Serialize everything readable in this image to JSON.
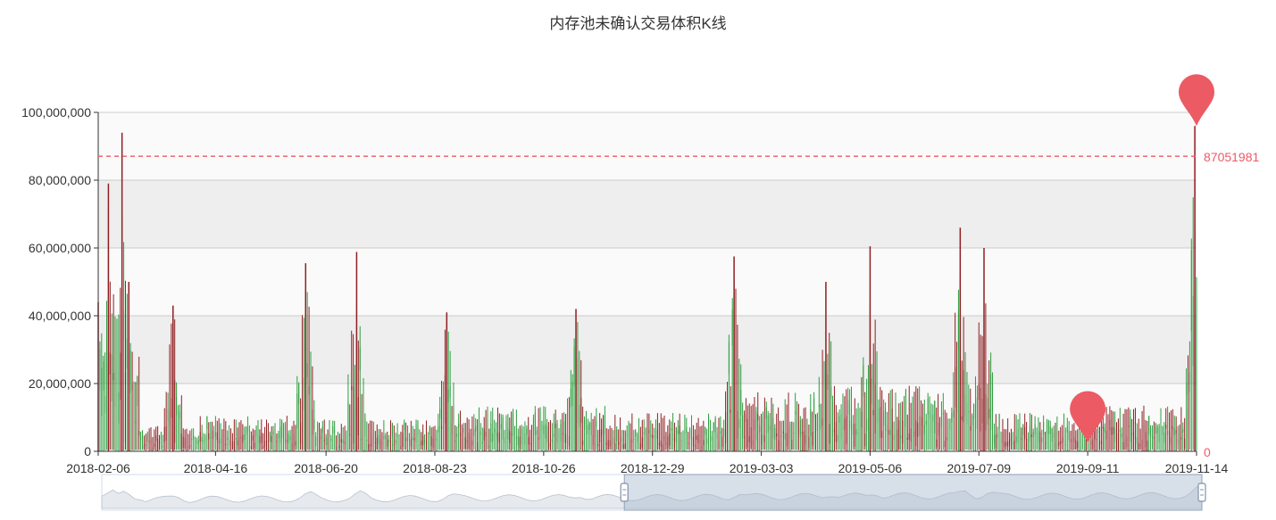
{
  "chart_data": {
    "type": "candlestick",
    "title": "内存池未确认交易体积K线",
    "xlabel": "",
    "ylabel": "",
    "ylim": [
      0,
      100000000
    ],
    "y_ticks": [
      "0",
      "20,000,000",
      "40,000,000",
      "60,000,000",
      "80,000,000",
      "100,000,000"
    ],
    "y_tick_values": [
      0,
      20000000,
      40000000,
      60000000,
      80000000,
      100000000
    ],
    "x_start": "2018-02-06",
    "x_end": "2019-11-14",
    "x_ticks": [
      "2018-02-06",
      "2018-04-16",
      "2018-06-20",
      "2018-08-23",
      "2018-10-26",
      "2018-12-29",
      "2019-03-03",
      "2019-05-06",
      "2019-07-09",
      "2019-09-11",
      "2019-11-14"
    ],
    "grid": true,
    "colors": {
      "up": "#2e9e3e",
      "down": "#8f1f22",
      "marker": "#ec5a64",
      "markline": "#ec5a64"
    },
    "markline": {
      "value": 87051981,
      "label": "87051981",
      "style": "dashed"
    },
    "right_axis_label": "0",
    "mark_points": [
      {
        "date": "2019-11-14",
        "value": 96000000,
        "kind": "max"
      },
      {
        "date": "2019-09-11",
        "value": 2500000,
        "kind": "min"
      }
    ],
    "peaks": [
      {
        "date": "2018-02-06",
        "value": 44000000
      },
      {
        "date": "2018-02-12",
        "value": 79000000
      },
      {
        "date": "2018-02-20",
        "value": 94000000
      },
      {
        "date": "2018-02-24",
        "value": 50000000
      },
      {
        "date": "2018-03-22",
        "value": 43000000
      },
      {
        "date": "2018-06-08",
        "value": 55500000
      },
      {
        "date": "2018-07-08",
        "value": 58800000
      },
      {
        "date": "2018-08-30",
        "value": 41000000
      },
      {
        "date": "2018-11-14",
        "value": 42000000
      },
      {
        "date": "2019-02-15",
        "value": 57500000
      },
      {
        "date": "2019-04-10",
        "value": 50000000
      },
      {
        "date": "2019-05-06",
        "value": 60500000
      },
      {
        "date": "2019-06-28",
        "value": 66000000
      },
      {
        "date": "2019-07-12",
        "value": 60000000
      },
      {
        "date": "2019-11-13",
        "value": 96000000
      }
    ]
  },
  "datazoom": {
    "start_fraction": 0.475,
    "end_fraction": 1.0
  }
}
